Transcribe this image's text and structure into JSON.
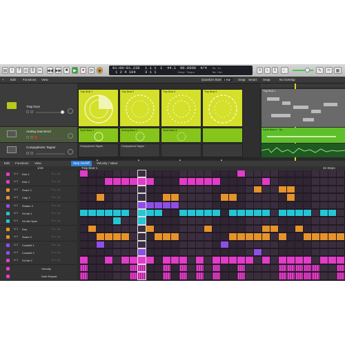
{
  "control_bar": {
    "position_time": "01:00:01.238",
    "position_bars": "1 2 4 104",
    "bar_beat": "1 1 1",
    "bar_beat2": "3 1 1",
    "beat_unit": "1",
    "sample_rate": "44.1",
    "tempo": "90.0000",
    "tempo_mode": "Keep Tempo",
    "time_sig": "4/4",
    "key_in": "No In",
    "key_out": "No Out"
  },
  "live_loops_toolbar": {
    "edit": "Edit",
    "functions": "Functions",
    "view": "View",
    "quantize_label": "Quantize Start",
    "quantize_value": "1 Bar",
    "snap": "Snap",
    "snap_value": "Smart"
  },
  "tracks_toolbar": {
    "snap": "Snap",
    "no_overlap": "No Overlap"
  },
  "tracks": [
    {
      "name": "Trap Door"
    },
    {
      "name": "Analog Saw Bend"
    },
    {
      "name": "Compuphonic Tapper"
    }
  ],
  "cells_row1": [
    "Trap Beat 1",
    "Trap Beat 2",
    "Trap Beat 3",
    "Trap Beat 4"
  ],
  "cells_row2": [
    "Synth Bass 1",
    "Analog Bass 2",
    "Synth Bass 3"
  ],
  "cells_row3": [
    "Compuphonic Tapper",
    "Compuphonic Tapper"
  ],
  "scenes": [
    "Verse",
    "Intro",
    "Chord",
    "Breakdown"
  ],
  "region_label": "Trap Beat 1",
  "region_label2": "Synth Bass 1 · Sp...",
  "step_toolbar": {
    "edit": "Edit",
    "functions": "Functions",
    "view": "View",
    "mode_on": "Step On/Off",
    "mode_vel": "Velocity / Value",
    "steps": "32 Steps",
    "region_name": "Trap Beat 1",
    "pattern_len": "1/16"
  },
  "rows": [
    {
      "name": "Kick 1",
      "color": "#e23cc8"
    },
    {
      "name": "Kick 2",
      "color": "#e23cc8"
    },
    {
      "name": "Snare 1",
      "color": "#e6932b"
    },
    {
      "name": "Clap 1",
      "color": "#e6932b"
    },
    {
      "name": "Shaker 2",
      "color": "#8f4fe6"
    },
    {
      "name": "Hi-Hat 1",
      "color": "#24c6d6"
    },
    {
      "name": "Hi-Hat Open",
      "color": "#24c6d6"
    },
    {
      "name": "Rim",
      "color": "#e6932b"
    },
    {
      "name": "Snare 2",
      "color": "#e6932b"
    },
    {
      "name": "Cowbell 1",
      "color": "#8f4fe6"
    },
    {
      "name": "Cowbell 2",
      "color": "#8f4fe6"
    },
    {
      "name": "Hi-Hat 2",
      "color": "#e23cc8"
    },
    {
      "name": "Velocity",
      "color": "#e23cc8"
    },
    {
      "name": "Note Repeat",
      "color": "#e23cc8"
    }
  ],
  "pattern": [
    [
      0,
      19
    ],
    [
      3,
      4,
      5,
      6,
      7,
      8,
      12,
      13,
      14,
      15,
      16,
      22
    ],
    [
      21,
      24,
      25
    ],
    [
      2,
      10,
      11,
      17,
      18,
      25
    ],
    [
      7,
      8,
      9,
      10,
      11
    ],
    [
      0,
      1,
      2,
      3,
      4,
      5,
      7,
      8,
      9,
      12,
      13,
      14,
      15,
      16,
      18,
      19,
      20,
      21,
      22,
      24,
      25,
      26,
      27,
      29,
      30
    ],
    [
      4,
      7
    ],
    [
      1,
      8,
      15,
      22,
      23,
      26
    ],
    [
      2,
      3,
      4,
      5,
      9,
      10,
      11,
      18,
      19,
      20,
      21,
      22,
      24,
      27,
      28,
      29,
      30,
      31
    ],
    [
      2,
      17
    ],
    [
      7,
      21
    ],
    [
      0,
      3,
      5,
      6,
      7,
      8,
      10,
      11,
      12,
      14,
      16,
      17,
      18,
      19,
      20,
      22,
      24,
      25,
      26,
      27,
      29,
      30,
      31
    ],
    [
      0,
      6,
      7,
      10,
      12,
      14,
      16,
      19,
      24,
      25,
      26,
      27,
      28,
      31
    ],
    [
      0,
      6,
      7,
      10,
      12,
      14,
      16,
      19,
      24,
      25,
      26,
      27,
      28,
      31
    ]
  ],
  "colors": {
    "cell_yellow": "#d4e02a",
    "cell_green": "#86c51c",
    "accent_blue": "#2f7fd4"
  }
}
